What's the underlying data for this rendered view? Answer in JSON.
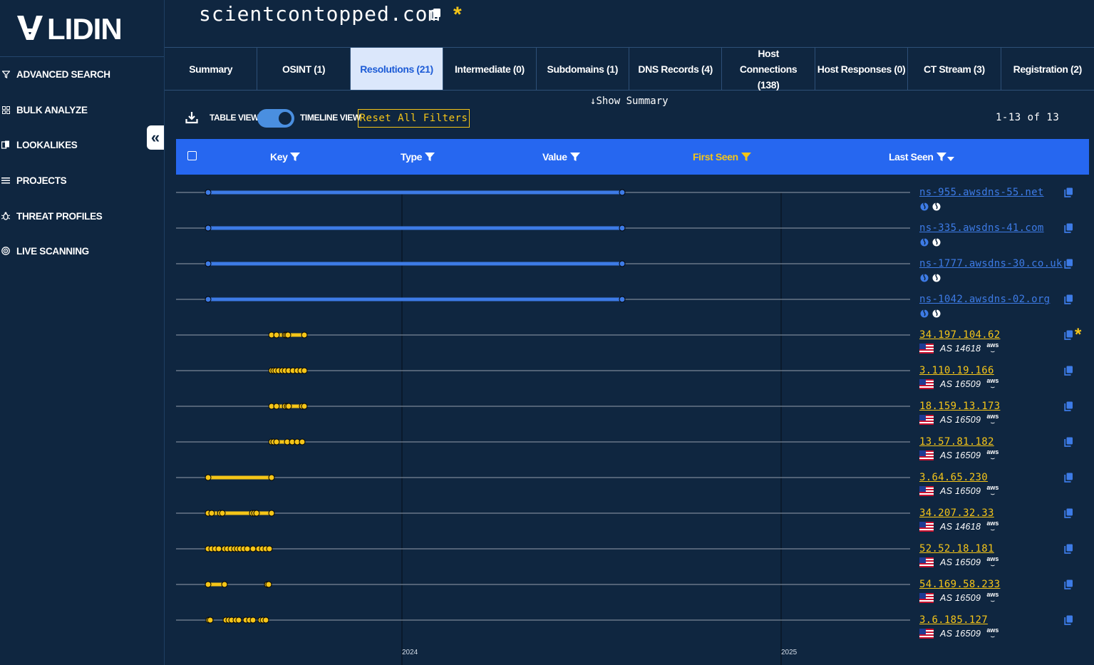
{
  "brand": {
    "logo_text": "V LIDIN"
  },
  "sidebar": {
    "items": [
      {
        "label": "ADVANCED SEARCH",
        "icon": "filter-icon"
      },
      {
        "label": "BULK ANALYZE",
        "icon": "grid-icon"
      },
      {
        "label": "LOOKALIKES",
        "icon": "lookalike-icon"
      },
      {
        "label": "PROJECTS",
        "icon": "list-icon"
      },
      {
        "label": "THREAT PROFILES",
        "icon": "bug-icon"
      },
      {
        "label": "LIVE SCANNING",
        "icon": "radar-icon"
      }
    ],
    "collapse_label": "«"
  },
  "header": {
    "domain": "scientcontopped.com",
    "star": "*"
  },
  "tabs": [
    {
      "label": "Summary",
      "active": false
    },
    {
      "label": "OSINT (1)",
      "active": false
    },
    {
      "label": "Resolutions (21)",
      "active": true
    },
    {
      "label": "Intermediate (0)",
      "active": false
    },
    {
      "label": "Subdomains (1)",
      "active": false
    },
    {
      "label": "DNS Records (4)",
      "active": false
    },
    {
      "label": "Host Connections (138)",
      "active": false
    },
    {
      "label": "Host Responses (0)",
      "active": false
    },
    {
      "label": "CT Stream (3)",
      "active": false
    },
    {
      "label": "Registration (2)",
      "active": false
    }
  ],
  "controls": {
    "show_summary": "Show Summary",
    "table_view": "TABLE VIEW",
    "timeline_view": "TIMELINE VIEW",
    "timeline_enabled": true,
    "reset": "Reset All Filters",
    "pagination": "1-13 of 13"
  },
  "columns": [
    {
      "label": "Key",
      "filter_active": false
    },
    {
      "label": "Type",
      "filter_active": false
    },
    {
      "label": "Value",
      "filter_active": false
    },
    {
      "label": "First Seen",
      "filter_active": true
    },
    {
      "label": "Last Seen",
      "filter_active": false,
      "sorted": "desc"
    }
  ],
  "timeline": {
    "years": [
      "2024",
      "2025"
    ]
  },
  "rows": [
    {
      "value": "ns-955.awsdns-55.net",
      "kind": "ns"
    },
    {
      "value": "ns-335.awsdns-41.com",
      "kind": "ns"
    },
    {
      "value": "ns-1777.awsdns-30.co.uk",
      "kind": "ns"
    },
    {
      "value": "ns-1042.awsdns-02.org",
      "kind": "ns"
    },
    {
      "value": "34.197.104.62",
      "kind": "ip",
      "asn": "AS 14618",
      "starred": true
    },
    {
      "value": "3.110.19.166",
      "kind": "ip",
      "asn": "AS 16509"
    },
    {
      "value": "18.159.13.173",
      "kind": "ip",
      "asn": "AS 16509"
    },
    {
      "value": "13.57.81.182",
      "kind": "ip",
      "asn": "AS 16509"
    },
    {
      "value": "3.64.65.230",
      "kind": "ip",
      "asn": "AS 16509"
    },
    {
      "value": "34.207.32.33",
      "kind": "ip",
      "asn": "AS 14618"
    },
    {
      "value": "52.52.18.181",
      "kind": "ip",
      "asn": "AS 16509"
    },
    {
      "value": "54.169.58.233",
      "kind": "ip",
      "asn": "AS 16509"
    },
    {
      "value": "3.6.185.127",
      "kind": "ip",
      "asn": "AS 16509"
    }
  ],
  "provider_label": "aws",
  "colors": {
    "accent": "#2667f0",
    "ns": "#3d7be6",
    "ip": "#f5c518",
    "bg": "#0f2640"
  }
}
